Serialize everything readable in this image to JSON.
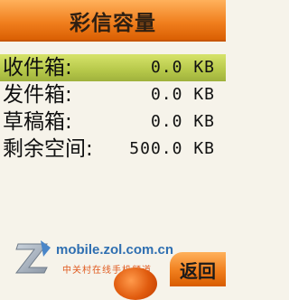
{
  "header": {
    "title": "彩信容量"
  },
  "rows": [
    {
      "label": "收件箱:",
      "value": "0.0 KB"
    },
    {
      "label": "发件箱:",
      "value": "0.0 KB"
    },
    {
      "label": "草稿箱:",
      "value": "0.0 KB"
    },
    {
      "label": "剩余空间:",
      "value": "500.0 KB"
    }
  ],
  "softkeys": {
    "back": "返回"
  },
  "watermark": {
    "domain": "mobile.zol.com.cn",
    "subtitle": "中关村在线手机频道"
  },
  "colors": {
    "header_orange": "#f07e1d",
    "selected_row": "#b6c84a",
    "background": "#f6f3ea",
    "watermark_blue": "#2f6fb1",
    "watermark_orange": "#e05a1f"
  }
}
